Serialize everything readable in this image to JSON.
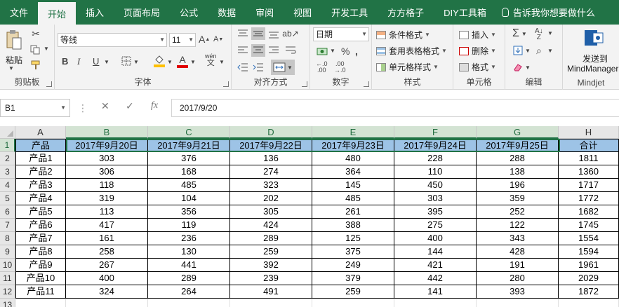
{
  "tabs": [
    "文件",
    "开始",
    "插入",
    "页面布局",
    "公式",
    "数据",
    "审阅",
    "视图",
    "开发工具",
    "方方格子",
    "DIY工具箱"
  ],
  "active_tab": "开始",
  "tell_me": "告诉我你想要做什么",
  "ribbon": {
    "clipboard": {
      "paste_label": "粘贴",
      "group_label": "剪贴板"
    },
    "font": {
      "name": "等线",
      "size": "11",
      "wen_label": "wén",
      "group_label": "字体",
      "font_color": "#e00000",
      "fill_color": "#ffc000"
    },
    "alignment": {
      "group_label": "对齐方式"
    },
    "number": {
      "format": "日期",
      "group_label": "数字"
    },
    "styles": {
      "conditional": "条件格式",
      "table_format": "套用表格格式",
      "cell_styles": "单元格样式",
      "group_label": "样式"
    },
    "cells": {
      "insert": "插入",
      "delete": "删除",
      "format": "格式",
      "group_label": "单元格"
    },
    "editing": {
      "group_label": "编辑"
    },
    "mindjet": {
      "send_line1": "发送到",
      "send_line2": "MindManager",
      "group_label": "Mindjet"
    }
  },
  "formula_bar": {
    "name_box": "B1",
    "fx": "fx",
    "value": "2017/9/20"
  },
  "sheet": {
    "columns": [
      "A",
      "B",
      "C",
      "D",
      "E",
      "F",
      "G",
      "H"
    ],
    "header_row": [
      "产品",
      "2017年9月20日",
      "2017年9月21日",
      "2017年9月22日",
      "2017年9月23日",
      "2017年9月24日",
      "2017年9月25日",
      "合计"
    ],
    "rows": [
      [
        "产品1",
        "303",
        "376",
        "136",
        "480",
        "228",
        "288",
        "1811"
      ],
      [
        "产品2",
        "306",
        "168",
        "274",
        "364",
        "110",
        "138",
        "1360"
      ],
      [
        "产品3",
        "118",
        "485",
        "323",
        "145",
        "450",
        "196",
        "1717"
      ],
      [
        "产品4",
        "319",
        "104",
        "202",
        "485",
        "303",
        "359",
        "1772"
      ],
      [
        "产品5",
        "113",
        "356",
        "305",
        "261",
        "395",
        "252",
        "1682"
      ],
      [
        "产品6",
        "417",
        "119",
        "424",
        "388",
        "275",
        "122",
        "1745"
      ],
      [
        "产品7",
        "161",
        "236",
        "289",
        "125",
        "400",
        "343",
        "1554"
      ],
      [
        "产品8",
        "258",
        "130",
        "259",
        "375",
        "144",
        "428",
        "1594"
      ],
      [
        "产品9",
        "267",
        "441",
        "392",
        "249",
        "421",
        "191",
        "1961"
      ],
      [
        "产品10",
        "400",
        "289",
        "239",
        "379",
        "442",
        "280",
        "2029"
      ],
      [
        "产品11",
        "324",
        "264",
        "491",
        "259",
        "141",
        "393",
        "1872"
      ]
    ],
    "row_numbers": [
      "1",
      "2",
      "3",
      "4",
      "5",
      "6",
      "7",
      "8",
      "9",
      "10",
      "11",
      "12",
      "13"
    ],
    "header_fill": "#9dc3e6"
  }
}
